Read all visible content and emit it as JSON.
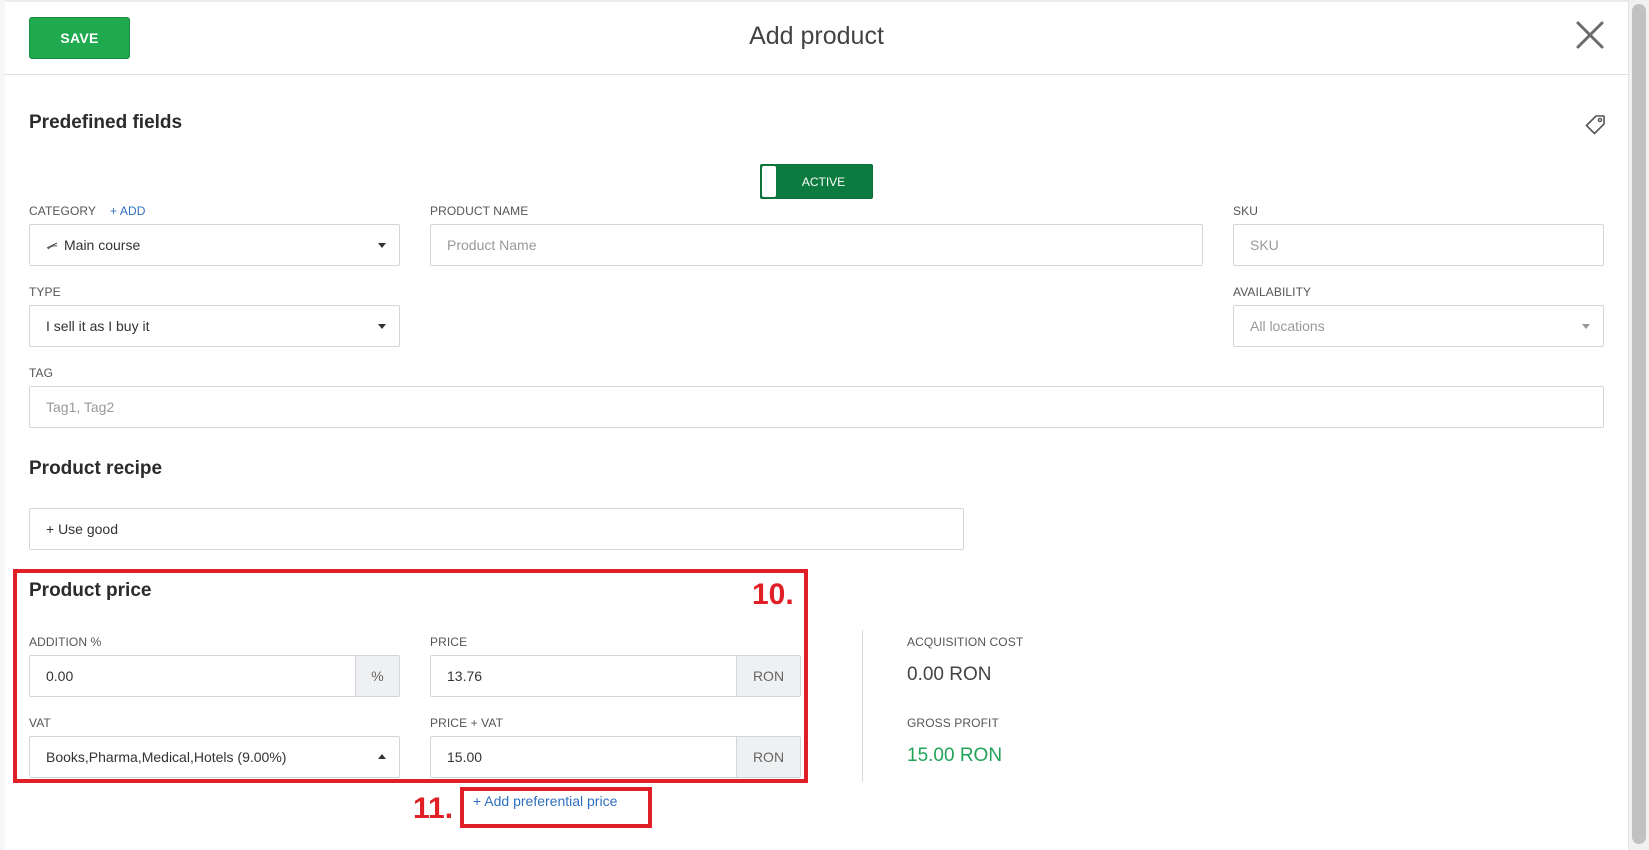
{
  "header": {
    "save_label": "SAVE",
    "title": "Add product"
  },
  "predefined": {
    "title": "Predefined fields",
    "status_toggle": {
      "label": "ACTIVE",
      "state": "on"
    },
    "category": {
      "label": "CATEGORY",
      "add_link": "+ ADD",
      "value": "Main course",
      "icon": "food-icon"
    },
    "product_name": {
      "label": "PRODUCT NAME",
      "placeholder": "Product Name"
    },
    "sku": {
      "label": "SKU",
      "placeholder": "SKU"
    },
    "type": {
      "label": "TYPE",
      "value": "I sell it as I buy it"
    },
    "availability": {
      "label": "AVAILABILITY",
      "placeholder": "All locations"
    },
    "tag": {
      "label": "TAG",
      "placeholder": "Tag1, Tag2"
    }
  },
  "recipe": {
    "title": "Product recipe",
    "use_good": "+ Use good"
  },
  "price": {
    "title": "Product price",
    "addition": {
      "label": "ADDITION %",
      "value": "0.00",
      "unit": "%"
    },
    "price": {
      "label": "PRICE",
      "value": "13.76",
      "unit": "RON"
    },
    "vat": {
      "label": "VAT",
      "value": "Books,Pharma,Medical,Hotels (9.00%)"
    },
    "price_vat": {
      "label": "PRICE + VAT",
      "value": "15.00",
      "unit": "RON"
    },
    "acquisition": {
      "label": "ACQUISITION COST",
      "value": "0.00 RON"
    },
    "gross_profit": {
      "label": "GROSS PROFIT",
      "value": "15.00 RON"
    },
    "preferential_link": "+ Add preferential price"
  },
  "annotations": {
    "n10": "10.",
    "n11": "11."
  },
  "colors": {
    "accent": "#1faa4f",
    "toggle": "#0d7a3f",
    "link": "#2f6fc0",
    "annotation": "#e01f26",
    "profit": "#22a35a"
  }
}
